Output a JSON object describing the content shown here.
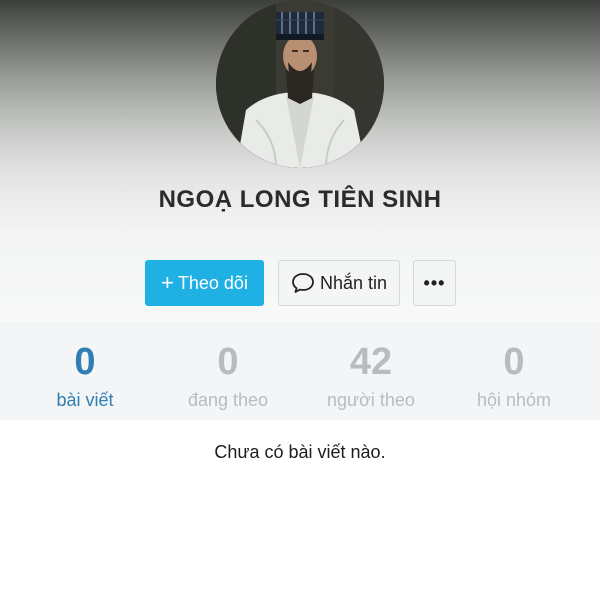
{
  "profile": {
    "name": "NGOẠ LONG TIÊN SINH",
    "avatar_icon": "profile-photo"
  },
  "actions": {
    "follow_label": "Theo dõi",
    "follow_icon": "plus-icon",
    "message_label": "Nhắn tin",
    "message_icon": "chat-bubble-icon",
    "more_label": "•••",
    "accent_color": "#1fb1e3"
  },
  "stats": [
    {
      "value": "0",
      "label": "bài viết",
      "active": true
    },
    {
      "value": "0",
      "label": "đang theo",
      "active": false
    },
    {
      "value": "42",
      "label": "người theo",
      "active": false
    },
    {
      "value": "0",
      "label": "hội nhóm",
      "active": false
    }
  ],
  "colors": {
    "active_tab": "#2f7fb4",
    "inactive_tab": "#b9bcbe"
  },
  "content": {
    "empty_message": "Chưa có bài viết nào."
  }
}
